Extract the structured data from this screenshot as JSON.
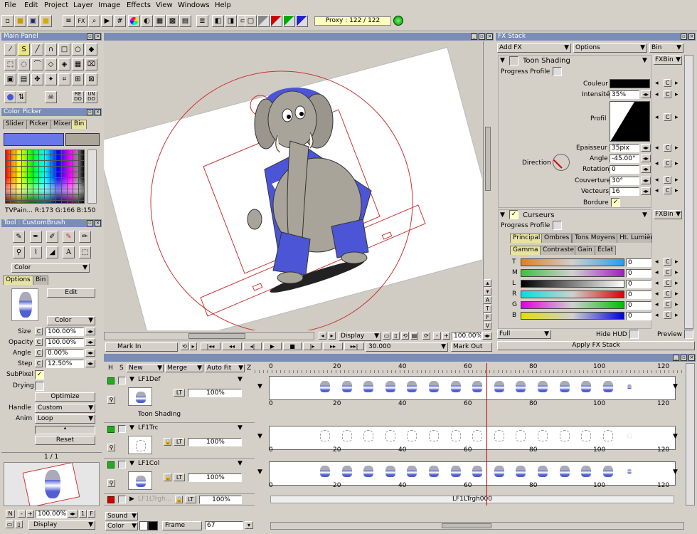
{
  "menubar": [
    "File",
    "Edit",
    "Project",
    "Layer",
    "Image",
    "Effects",
    "View",
    "Windows",
    "Help"
  ],
  "toolbar": {
    "proxy": "Proxy : 122 / 122",
    "fx": "FX"
  },
  "main_panel": {
    "title": "Main Panel"
  },
  "color_picker": {
    "title": "Color Picker",
    "tabs": [
      "Slider",
      "Picker",
      "Mixer",
      "Bin"
    ],
    "info": "TVPain... R:173 G:166 B:150"
  },
  "tool_panel": {
    "title": "Tool : CustomBrush",
    "mode": "Color",
    "tabs": [
      "Options",
      "Bin"
    ],
    "edit": "Edit",
    "color_select": "Color",
    "params": [
      {
        "label": "Size",
        "value": "100.00%"
      },
      {
        "label": "Opacity",
        "value": "100.00%"
      },
      {
        "label": "Angle",
        "value": "0.00%"
      },
      {
        "label": "Step",
        "value": "12.50%"
      }
    ],
    "subpixel": "SubPixel",
    "drying": "Drying",
    "optimize": "Optimize",
    "handle_label": "Handle",
    "handle_value": "Custom",
    "anim_label": "Anim",
    "anim_value": "Loop",
    "reset": "Reset"
  },
  "navigator": {
    "page": "1 / 1",
    "n": "N",
    "minus": "-",
    "plus": "+",
    "zoom": "100.00%",
    "one": "1",
    "f": "F",
    "display": "Display"
  },
  "canvas": {
    "display": "Display",
    "zoom": "100.00%",
    "mark_in": "Mark In",
    "mark_out": "Mark Out",
    "time": "30.000",
    "side_letters": [
      "A",
      "T",
      "F",
      "V"
    ]
  },
  "fx_stack": {
    "title": "FX Stack",
    "add_fx": "Add FX",
    "options": "Options",
    "bin": "Bin",
    "fxbin": "FXBin",
    "toon": {
      "name": "Toon Shading",
      "progress": "Progress Profile",
      "couleur": "Couleur",
      "intensite": "Intensité",
      "intensite_val": "35%",
      "profil": "Profil",
      "epaisseur": "Epaisseur",
      "epaisseur_val": "35pix",
      "angle": "Angle",
      "angle_val": "-45.00°",
      "direction": "Direction",
      "rotation": "Rotation",
      "rotation_val": "0",
      "couverture": "Couverture",
      "couverture_val": "30°",
      "vecteurs": "Vecteurs",
      "vecteurs_val": "16",
      "bordure": "Bordure"
    },
    "curseurs": {
      "name": "Curseurs",
      "progress": "Progress Profile",
      "tabs1": [
        "Principal",
        "Ombres",
        "Tons Moyens",
        "Ht. Lumière"
      ],
      "tabs2": [
        "Gamma",
        "Contraste",
        "Gain",
        "Éclat"
      ],
      "rows": [
        {
          "ch": "T",
          "v": "0"
        },
        {
          "ch": "M",
          "v": "0"
        },
        {
          "ch": "L",
          "v": "0"
        },
        {
          "ch": "R",
          "v": "0"
        },
        {
          "ch": "G",
          "v": "0"
        },
        {
          "ch": "B",
          "v": "0"
        }
      ]
    },
    "full": "Full",
    "hide_hud": "Hide HUD",
    "preview": "Preview",
    "apply": "Apply FX Stack",
    "c": "C"
  },
  "timeline": {
    "headers": {
      "h": "H",
      "s": "S",
      "new": "New",
      "merge": "Merge",
      "autofit": "Auto Fit",
      "z": "Z"
    },
    "layers": [
      {
        "name": "LF1Def",
        "opacity": "100%",
        "fx": "Toon Shading",
        "lt": "LT"
      },
      {
        "name": "LF1Trc",
        "opacity": "100%",
        "lt": "LT"
      },
      {
        "name": "LF1Col",
        "opacity": "100%",
        "lt": "LT"
      },
      {
        "name": "LF1LTrgh...",
        "opacity": "100%",
        "lt": "LT"
      }
    ],
    "ruler": [
      "0",
      "20",
      "40",
      "60",
      "80",
      "100",
      "120"
    ],
    "track_label": "LF1LTrgh000",
    "sound": "Sound",
    "color": "Color",
    "frame_label": "Frame",
    "frame_value": "67"
  },
  "colors": {
    "title_blue": "#7a8cb8",
    "timeline_red": "#c00000",
    "elephant_blue": "#4b55d6"
  }
}
